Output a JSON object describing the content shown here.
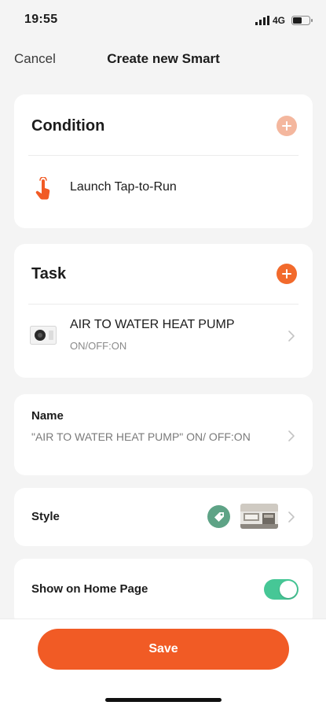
{
  "status_bar": {
    "time": "19:55",
    "network": "4G",
    "icons": [
      "signal-icon",
      "battery-icon"
    ]
  },
  "nav": {
    "cancel_label": "Cancel",
    "title": "Create new Smart"
  },
  "condition": {
    "title": "Condition",
    "add_icon": "plus-icon",
    "item": {
      "icon": "tap-hand-icon",
      "label": "Launch Tap-to-Run"
    }
  },
  "task": {
    "title": "Task",
    "add_icon": "plus-icon",
    "item": {
      "icon": "heat-pump-device-icon",
      "device_name": "AIR TO WATER HEAT PUMP",
      "action": "ON/OFF:ON"
    }
  },
  "name_row": {
    "label": "Name",
    "value": "\"AIR TO WATER HEAT PUMP\" ON/ OFF:ON"
  },
  "style_row": {
    "label": "Style",
    "icon": "tag-icon",
    "cover": "cover-image"
  },
  "home_row": {
    "label": "Show on Home Page",
    "toggle_on": true
  },
  "footer": {
    "save_label": "Save"
  },
  "colors": {
    "accent": "#f15b25",
    "accent_light": "#f4b79e",
    "toggle_on": "#46c796",
    "style_badge": "#5ea386",
    "background": "#f4f4f4"
  }
}
